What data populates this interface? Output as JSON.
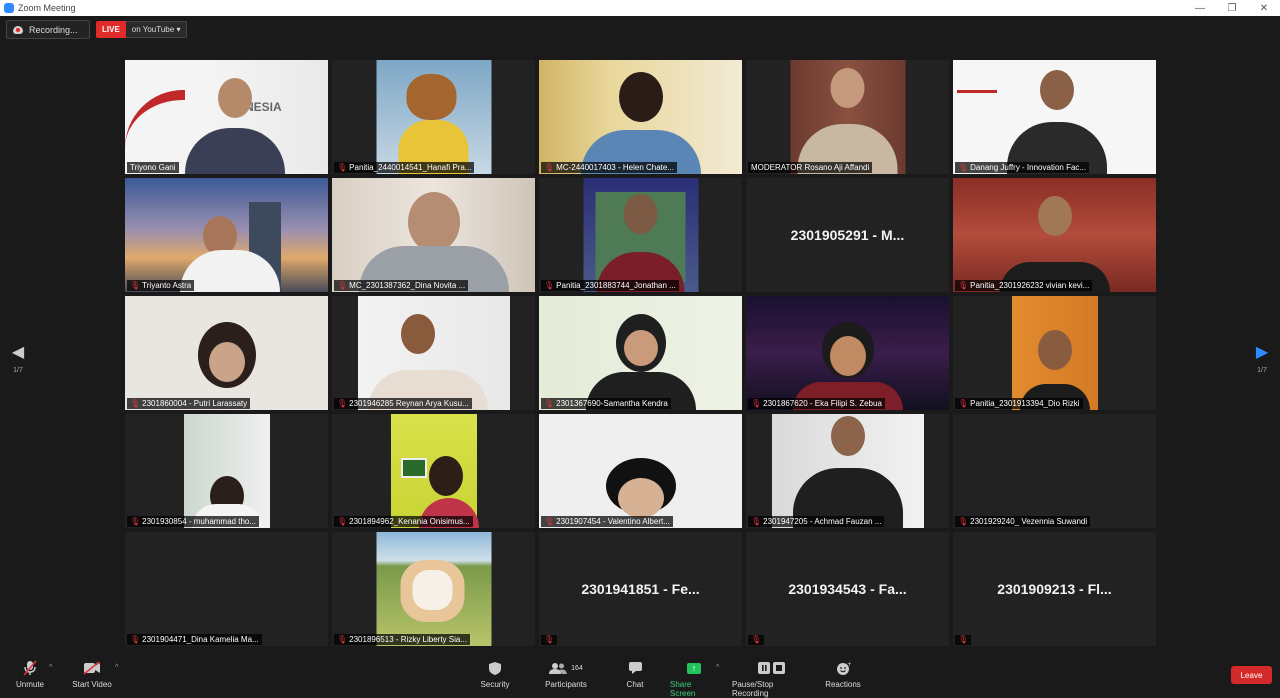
{
  "window": {
    "title": "Zoom Meeting",
    "minimize": "—",
    "maximize": "❐",
    "close": "✕"
  },
  "status": {
    "recording": "Recording...",
    "live": "LIVE",
    "live_target": "on YouTube",
    "dropdown": "▾"
  },
  "nav": {
    "page_left": "1/7",
    "page_right": "1/7"
  },
  "tiles": [
    {
      "name": "Triyono Gani",
      "type": "video",
      "muted": false
    },
    {
      "name": "Panitia_2440014541_Hanafi Pra...",
      "type": "video",
      "muted": true
    },
    {
      "name": "MC-2440017403 - Helen Chate...",
      "type": "video",
      "muted": true,
      "active": true
    },
    {
      "name": "MODERATOR Rosano Aji Affandi",
      "type": "video",
      "muted": false
    },
    {
      "name": "Danang Juffry - Innovation Fac...",
      "type": "video",
      "muted": true
    },
    {
      "name": "Triyanto Astra",
      "type": "video",
      "muted": true
    },
    {
      "name": "MC_2301387362_Dina Novita ...",
      "type": "video",
      "muted": true
    },
    {
      "name": "Panitia_2301883744_Jonathan ...",
      "type": "video",
      "muted": true
    },
    {
      "name": "2301905291 - M...",
      "type": "placeholder",
      "muted": false
    },
    {
      "name": "Panitia_2301926232 vivian kevi...",
      "type": "video",
      "muted": true
    },
    {
      "name": "2301860004 - Putri Larassaty",
      "type": "video",
      "muted": true
    },
    {
      "name": "2301946285 Reynan Arya Kusu...",
      "type": "video",
      "muted": true
    },
    {
      "name": "2301367690-Samantha Kendra",
      "type": "video",
      "muted": true
    },
    {
      "name": "2301867620 - Eka Filipi S. Zebua",
      "type": "video",
      "muted": true
    },
    {
      "name": "Panitia_2301913394_Dio Rizki",
      "type": "video",
      "muted": true
    },
    {
      "name": "2301930854 - muhammad tho...",
      "type": "video",
      "muted": true
    },
    {
      "name": "2301894962_Kenania Onisimus...",
      "type": "video",
      "muted": true
    },
    {
      "name": "2301907454 - Valentino Albert...",
      "type": "video",
      "muted": true
    },
    {
      "name": "2301947205 - Achmad Fauzan ...",
      "type": "video",
      "muted": true
    },
    {
      "name": "2301929240_ Vezennia Suwandi",
      "type": "blank",
      "muted": true
    },
    {
      "name": "2301904471_Dina Kamelia Ma...",
      "type": "blank",
      "muted": true
    },
    {
      "name": "2301896513 - Rizky Liberty Sia...",
      "type": "video",
      "muted": true
    },
    {
      "name": "2301941851 - Fe...",
      "type": "placeholder",
      "muted": true,
      "nameplate": ""
    },
    {
      "name": "2301934543 - Fa...",
      "type": "placeholder",
      "muted": true,
      "nameplate": ""
    },
    {
      "name": "2301909213 - Fl...",
      "type": "placeholder",
      "muted": true,
      "nameplate": ""
    }
  ],
  "toolbar": {
    "unmute": "Unmute",
    "start_video": "Start Video",
    "security": "Security",
    "participants": "Participants",
    "participants_count": "164",
    "chat": "Chat",
    "share_screen": "Share Screen",
    "pause_recording": "Pause/Stop Recording",
    "reactions": "Reactions",
    "leave": "Leave",
    "caret": "^"
  },
  "colors": {
    "accent": "#2d8cff",
    "live": "#e02b2b",
    "active_speaker": "#c8e63c",
    "share": "#21c25c",
    "leave": "#d42a2a"
  }
}
